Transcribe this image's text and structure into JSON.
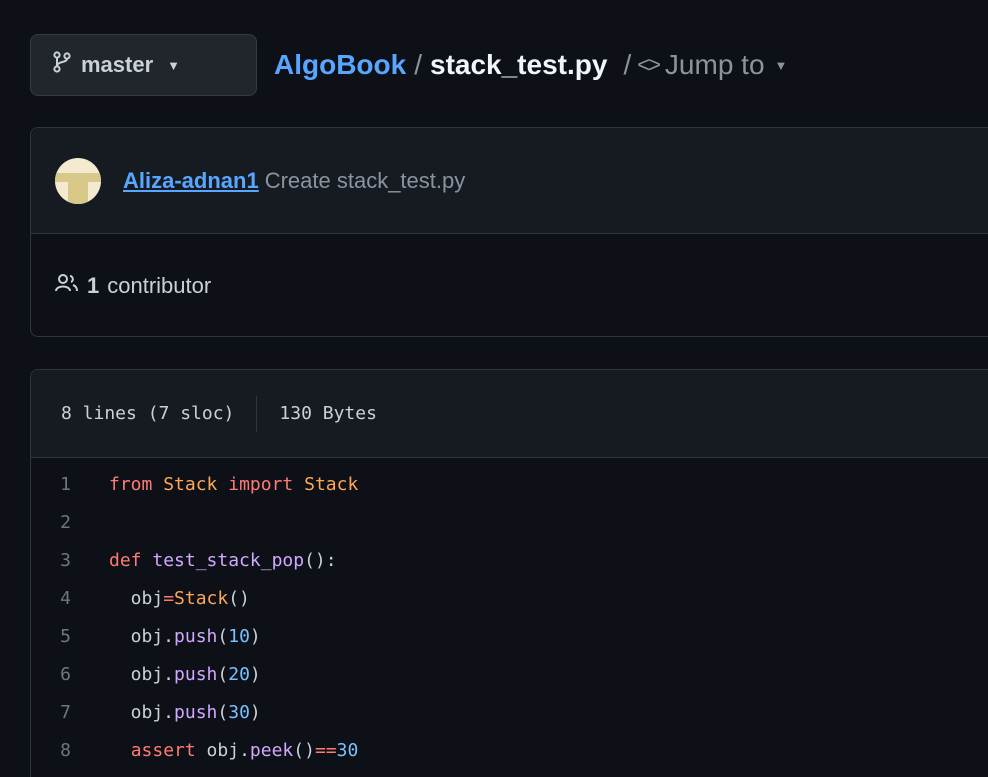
{
  "branch": {
    "name": "master",
    "icon": "git-branch-icon"
  },
  "breadcrumb": {
    "repo": "AlgoBook",
    "separator": "/",
    "file": "stack_test.py",
    "separator2": "/",
    "jump_label": "Jump to"
  },
  "commit": {
    "author": "Aliza-adnan1",
    "message": "Create stack_test.py"
  },
  "contributors": {
    "count": "1",
    "label": "contributor"
  },
  "file_info": {
    "lines": "8 lines (7 sloc)",
    "size": "130 Bytes"
  },
  "code_lines": [
    {
      "n": "1",
      "tokens": [
        [
          "kw",
          "from"
        ],
        [
          "plain",
          " "
        ],
        [
          "cls",
          "Stack"
        ],
        [
          "plain",
          " "
        ],
        [
          "kw",
          "import"
        ],
        [
          "plain",
          " "
        ],
        [
          "cls",
          "Stack"
        ]
      ]
    },
    {
      "n": "2",
      "tokens": []
    },
    {
      "n": "3",
      "tokens": [
        [
          "kw",
          "def"
        ],
        [
          "plain",
          " "
        ],
        [
          "fn",
          "test_stack_pop"
        ],
        [
          "plain",
          "():"
        ]
      ]
    },
    {
      "n": "4",
      "tokens": [
        [
          "plain",
          "  obj"
        ],
        [
          "op",
          "="
        ],
        [
          "cls",
          "Stack"
        ],
        [
          "plain",
          "()"
        ]
      ]
    },
    {
      "n": "5",
      "tokens": [
        [
          "plain",
          "  obj."
        ],
        [
          "fn",
          "push"
        ],
        [
          "plain",
          "("
        ],
        [
          "num",
          "10"
        ],
        [
          "plain",
          ")"
        ]
      ]
    },
    {
      "n": "6",
      "tokens": [
        [
          "plain",
          "  obj."
        ],
        [
          "fn",
          "push"
        ],
        [
          "plain",
          "("
        ],
        [
          "num",
          "20"
        ],
        [
          "plain",
          ")"
        ]
      ]
    },
    {
      "n": "7",
      "tokens": [
        [
          "plain",
          "  obj."
        ],
        [
          "fn",
          "push"
        ],
        [
          "plain",
          "("
        ],
        [
          "num",
          "30"
        ],
        [
          "plain",
          ")"
        ]
      ]
    },
    {
      "n": "8",
      "tokens": [
        [
          "plain",
          "  "
        ],
        [
          "kw",
          "assert"
        ],
        [
          "plain",
          " obj."
        ],
        [
          "fn",
          "peek"
        ],
        [
          "plain",
          "()"
        ],
        [
          "op",
          "=="
        ],
        [
          "num",
          "30"
        ]
      ]
    }
  ],
  "colors": {
    "background": "#0d1117",
    "link": "#58a6ff",
    "keyword": "#ff7b72",
    "class": "#ffa657",
    "function": "#d2a8ff",
    "number": "#79c0ff"
  }
}
